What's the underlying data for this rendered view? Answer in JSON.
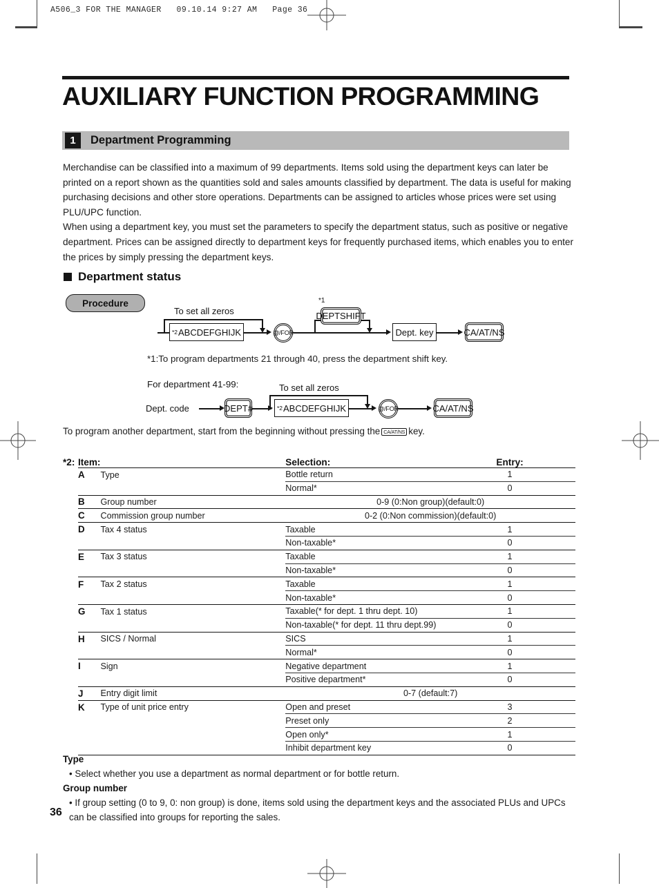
{
  "runhead": "A506_3 FOR THE MANAGER   09.10.14 9:27 AM   Page 36",
  "chapter_title": "AUXILIARY FUNCTION PROGRAMMING",
  "section": {
    "number": "1",
    "title": "Department Programming"
  },
  "body": {
    "p1": "Merchandise can be classified into a maximum of 99 departments.  Items sold using the department keys can later be printed on a report shown as the quantities sold and sales amounts classified by department.  The data is useful for making purchasing decisions and other store operations.  Departments can be assigned to articles whose prices were set using PLU/UPC function.",
    "p2": "When using a department key, you must set the parameters to specify the department status, such as positive or negative department.  Prices can be assigned directly to department keys for frequently purchased items, which enables you to enter the prices by simply pressing the department keys."
  },
  "subhead": "Department status",
  "procedure_badge": "Procedure",
  "diagram1": {
    "loop_label": "To set all zeros",
    "param_sup": "*2",
    "param_box": "ABCDEFGHIJK",
    "for_key": "@/FOR",
    "shift_sup": "*1",
    "shift_key": "DEPTSHIFT",
    "dept_key": "Dept. key",
    "finalize_key": "CA/AT/NS"
  },
  "note1": "*1:To program departments 21 through 40, press the department shift key.",
  "diagram2": {
    "heading": "For department 41-99:",
    "dept_code_label": "Dept. code",
    "dept_num_key": "DEPT#",
    "loop_label": "To set all zeros",
    "param_sup": "*2",
    "param_box": "ABCDEFGHIJK",
    "for_key": "@/FOR",
    "finalize_key": "CA/AT/NS"
  },
  "reprogram_note": {
    "before": "To program another department, start from the beginning without pressing the",
    "key": "CA/AT/NS",
    "after": "key."
  },
  "table": {
    "star": "*2:",
    "headers": {
      "item": "Item:",
      "selection": "Selection:",
      "entry": "Entry:"
    },
    "rows": [
      {
        "letter": "A",
        "name": "Type",
        "options": [
          {
            "selection": "Bottle return",
            "entry": "1"
          },
          {
            "selection": "Normal*",
            "entry": "0"
          }
        ]
      },
      {
        "letter": "B",
        "name": "Group number",
        "span": true,
        "options": [
          {
            "selection": "",
            "entry": "0-9 (0:Non group)(default:0)"
          }
        ]
      },
      {
        "letter": "C",
        "name": "Commission group number",
        "span": true,
        "options": [
          {
            "selection": "",
            "entry": "0-2 (0:Non commission)(default:0)"
          }
        ]
      },
      {
        "letter": "D",
        "name": "Tax 4 status",
        "options": [
          {
            "selection": "Taxable",
            "entry": "1"
          },
          {
            "selection": "Non-taxable*",
            "entry": "0"
          }
        ]
      },
      {
        "letter": "E",
        "name": "Tax 3 status",
        "options": [
          {
            "selection": "Taxable",
            "entry": "1"
          },
          {
            "selection": "Non-taxable*",
            "entry": "0"
          }
        ]
      },
      {
        "letter": "F",
        "name": "Tax 2 status",
        "options": [
          {
            "selection": "Taxable",
            "entry": "1"
          },
          {
            "selection": "Non-taxable*",
            "entry": "0"
          }
        ]
      },
      {
        "letter": "G",
        "name": "Tax 1 status",
        "options": [
          {
            "selection": "Taxable(* for dept. 1 thru dept. 10)",
            "entry": "1"
          },
          {
            "selection": "Non-taxable(* for dept. 11 thru dept.99)",
            "entry": "0"
          }
        ]
      },
      {
        "letter": "H",
        "name": "SICS / Normal",
        "options": [
          {
            "selection": "SICS",
            "entry": "1"
          },
          {
            "selection": "Normal*",
            "entry": "0"
          }
        ]
      },
      {
        "letter": "I",
        "name": "Sign",
        "options": [
          {
            "selection": "Negative department",
            "entry": "1"
          },
          {
            "selection": "Positive department*",
            "entry": "0"
          }
        ]
      },
      {
        "letter": "J",
        "name": "Entry digit limit",
        "span": true,
        "options": [
          {
            "selection": "",
            "entry": "0-7 (default:7)"
          }
        ]
      },
      {
        "letter": "K",
        "name": "Type of unit price entry",
        "options": [
          {
            "selection": "Open and preset",
            "entry": "3"
          },
          {
            "selection": "Preset only",
            "entry": "2"
          },
          {
            "selection": "Open only*",
            "entry": "1"
          },
          {
            "selection": "Inhibit department key",
            "entry": "0"
          }
        ]
      }
    ]
  },
  "footer": {
    "h1": "Type",
    "b1": "• Select whether you use a department as normal department or for bottle return.",
    "h2": "Group number",
    "b2": "• If group setting (0 to 9, 0: non group) is done, items sold using the department keys and the associated PLUs and UPCs can be classified into groups for reporting the sales."
  },
  "page_number": "36"
}
